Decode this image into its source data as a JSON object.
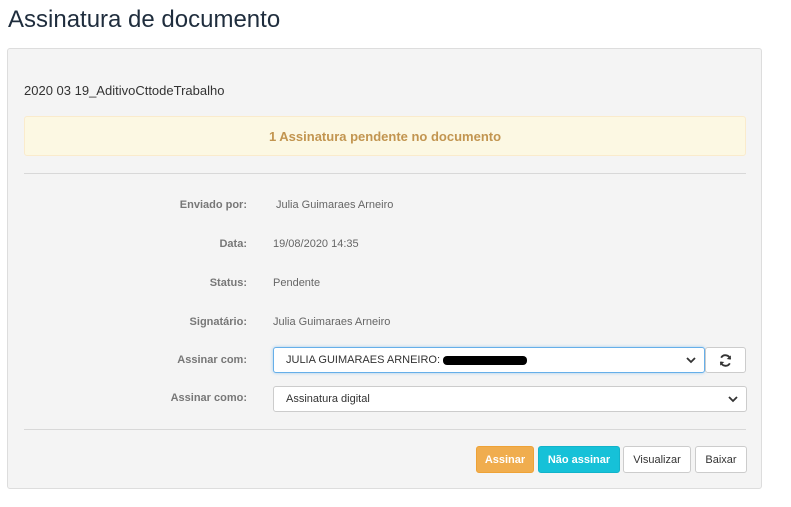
{
  "page": {
    "title": "Assinatura de documento"
  },
  "document": {
    "name": "2020 03 19_AditivoCttodeTrabalho"
  },
  "alert": {
    "text": "1 Assinatura pendente no documento"
  },
  "details": {
    "enviado_por": {
      "label": "Enviado por:",
      "value": "Julia Guimaraes Arneiro"
    },
    "data": {
      "label": "Data:",
      "value": "19/08/2020 14:35"
    },
    "status": {
      "label": "Status:",
      "value": "Pendente"
    },
    "signatario": {
      "label": "Signatário:",
      "value": "Julia Guimaraes Arneiro"
    }
  },
  "assinar_com": {
    "label": "Assinar com:",
    "value": "JULIA GUIMARAES ARNEIRO:"
  },
  "assinar_como": {
    "label": "Assinar como:",
    "value": "Assinatura digital"
  },
  "buttons": {
    "assinar": "Assinar",
    "nao_assinar": "Não assinar",
    "visualizar": "Visualizar",
    "baixar": "Baixar"
  },
  "icons": {
    "refresh": "refresh-icon",
    "chevron": "chevron-down-icon"
  },
  "colors": {
    "warning": "#f0ad4e",
    "info": "#16c1d8",
    "alert_bg": "#fcf8e3",
    "alert_text": "#c29550"
  }
}
